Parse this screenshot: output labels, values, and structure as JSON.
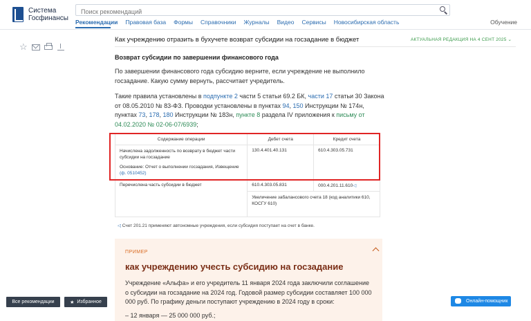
{
  "header": {
    "logo_line1": "Система",
    "logo_line2": "Госфинансы",
    "search_placeholder": "Поиск рекомендаций",
    "nav": [
      "Рекомендации",
      "Правовая база",
      "Формы",
      "Справочники",
      "Журналы",
      "Видео",
      "Сервисы",
      "Новосибирская область"
    ],
    "training": "Обучение"
  },
  "doc": {
    "title": "Как учреждению отразить в бухучете возврат субсидии на госзадание в бюджет",
    "edition": "АКТУАЛЬНАЯ РЕДАКЦИЯ НА 4 СЕНТ 2025"
  },
  "section": {
    "heading": "Возврат субсидии по завершении финансового года",
    "p1": "По завершении финансового года субсидию верните, если учреждение не выполнило госзадание. Какую сумму вернуть, рассчитает учредитель.",
    "p2_parts": {
      "a": "Такие правила установлены в ",
      "l1": "подпункте 2",
      "b": " части 5 статьи 69.2 БК, ",
      "l2": "части 17",
      "c": " статьи 30 Закона от 08.05.2010 № 83-ФЗ. Проводки установлены в пунктах ",
      "l3": "94",
      "d": ", ",
      "l4": "150",
      "e": " Инструкции № 174н, пунктах ",
      "l5": "73",
      "f": ", ",
      "l6": "178",
      "g": ", ",
      "l7": "180",
      "h": " Инструкции № 183н, ",
      "l8": "пункте 8",
      "i": " раздела IV приложения к ",
      "l9": "письму от 04.02.2020 № 02-06-07/6939",
      "j": ";"
    }
  },
  "table": {
    "headers": [
      "Содержание операции",
      "Дебет счета",
      "Кредит счета"
    ],
    "row1": {
      "op": "Начислена задолженность по возврату в бюджет части субсидии на госзадание",
      "basis": "Основание: Отчет о выполнении госзадания, Извещение",
      "basis_link": "(ф. 0510452)",
      "debit": "130.4.401.40.131",
      "credit": "610.4.303.05.731"
    },
    "row2": {
      "op": "Перечислена часть субсидии в бюджет",
      "debit": "610.4.303.05.831",
      "credit": "000.4.201.11.610",
      "credit_mark": "◁",
      "extra": "Увеличение забалансового счета 18 (код аналитики 610, КОСГУ 610)"
    },
    "note_mark": "◁",
    "note": " Счет 201.21 применяют автономные учреждения, если субсидия поступает на счет в банке."
  },
  "example": {
    "label": "ПРИМЕР",
    "title": "как учреждению учесть субсидию на госзадание",
    "text": "Учреждение «Альфа» и его учредитель 11 января 2024 года заключили соглашение о субсидии на госзадание на 2024 год. Годовой размер субсидии составляет 100 000 000 руб. По графику деньги поступают учреждению в 2024 году в сроки:",
    "item": "– 12 января — 25 000 000 руб.;"
  },
  "footer": {
    "all_recs": "Все рекомендации",
    "favorites": "Избранное",
    "favorites_icon": "★",
    "assistant": "Онлайн-помощник"
  },
  "colors": {
    "accent": "#2b6cb0",
    "green": "#3a9a4a",
    "highlight": "#e02424",
    "example_bg": "#fdf2ea"
  }
}
